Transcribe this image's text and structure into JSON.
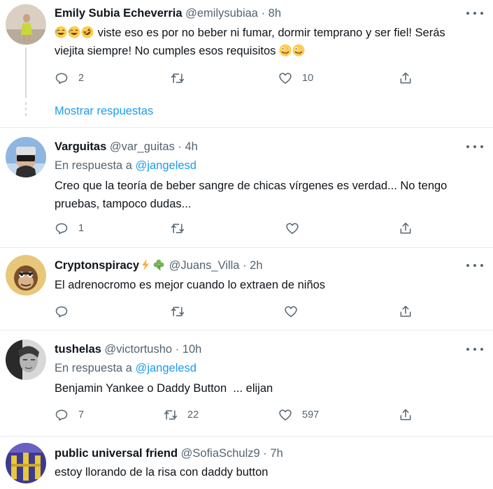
{
  "tweets": [
    {
      "name": "Emily Subia Echeverria",
      "handle": "@emilysubiaa",
      "separator": "·",
      "time": "8h",
      "text": "viste eso es por no beber ni fumar, dormir temprano y ser fiel! Serás viejita siempre! No cumples esos requisitos",
      "reply_count": "2",
      "retweet_count": "",
      "like_count": "10",
      "show_replies": "Mostrar respuestas"
    },
    {
      "name": "Varguitas",
      "handle": "@var_guitas",
      "separator": "·",
      "time": "4h",
      "reply_prefix": "En respuesta a",
      "reply_mention": "@jangelesd",
      "text": "Creo que la teoría de beber sangre de chicas vírgenes es verdad... No tengo pruebas, tampoco dudas...",
      "reply_count": "1",
      "retweet_count": "",
      "like_count": ""
    },
    {
      "name": "Cryptonspiracy",
      "name_emojis": [
        "lightning-emoji",
        "shamrock-emoji"
      ],
      "handle": "@Juans_Villa",
      "separator": "·",
      "time": "2h",
      "text": "El adrenocromo es mejor cuando lo extraen de niños",
      "reply_count": "",
      "retweet_count": "",
      "like_count": ""
    },
    {
      "name": "tushelas",
      "handle": "@victortusho",
      "separator": "·",
      "time": "10h",
      "reply_prefix": "En respuesta a",
      "reply_mention": "@jangelesd",
      "text": "Benjamin Yankee o Daddy Button  ... elijan",
      "reply_count": "7",
      "retweet_count": "22",
      "like_count": "597"
    },
    {
      "name": "public universal friend",
      "handle": "@SofiaSchulz9",
      "separator": "·",
      "time": "7h",
      "text": "estoy llorando de la risa con daddy button"
    }
  ],
  "icons": {
    "reply": "reply-icon",
    "retweet": "retweet-icon",
    "like": "heart-icon",
    "share": "share-icon",
    "more": "more-icon"
  },
  "colors": {
    "accent": "#1d9bf0",
    "secondary_text": "#536471",
    "divider": "#e6ecf0"
  }
}
